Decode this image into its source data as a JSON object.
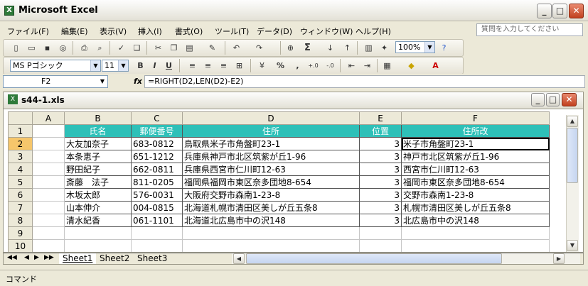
{
  "app": {
    "title": "Microsoft Excel"
  },
  "menu": {
    "items": [
      "ファイル(F)",
      "編集(E)",
      "表示(V)",
      "挿入(I)",
      "書式(O)",
      "ツール(T)",
      "データ(D)",
      "ウィンドウ(W)",
      "ヘルプ(H)"
    ],
    "help_placeholder": "質問を入力してください"
  },
  "toolbar": {
    "zoom": "100%",
    "font_name": "MS Pゴシック",
    "font_size": "11",
    "bold": "B",
    "italic": "I",
    "underline": "U",
    "percent": "%",
    "comma": ",",
    "sigma": "Σ"
  },
  "formula_bar": {
    "cell_ref": "F2",
    "fx": "fx",
    "formula": "=RIGHT(D2,LEN(D2)-E2)"
  },
  "workbook": {
    "title": "s44-1.xls"
  },
  "sheet": {
    "columns": [
      "A",
      "B",
      "C",
      "D",
      "E",
      "F"
    ],
    "row_numbers": [
      "1",
      "2",
      "3",
      "4",
      "5",
      "6",
      "7",
      "8",
      "9",
      "10"
    ],
    "header": [
      "氏名",
      "郵便番号",
      "住所",
      "位置",
      "住所改"
    ],
    "rows": [
      [
        "大友加奈子",
        "683-0812",
        "鳥取県米子市角盤町23-1",
        "3",
        "米子市角盤町23-1"
      ],
      [
        "本条恵子",
        "651-1212",
        "兵庫県神戸市北区筑紫が丘1-96",
        "3",
        "神戸市北区筑紫が丘1-96"
      ],
      [
        "野田紀子",
        "662-0811",
        "兵庫県西宮市仁川町12-63",
        "3",
        "西宮市仁川町12-63"
      ],
      [
        "斎藤　法子",
        "811-0205",
        "福岡県福岡市東区奈多団地8-654",
        "3",
        "福岡市東区奈多団地8-654"
      ],
      [
        "木坂太郎",
        "576-0031",
        "大阪府交野市森南1-23-8",
        "3",
        "交野市森南1-23-8"
      ],
      [
        "山本伸介",
        "004-0815",
        "北海道札幌市清田区美しが丘五条8",
        "3",
        "札幌市清田区美しが丘五条8"
      ],
      [
        "清水紀香",
        "061-1101",
        "北海道北広島市中の沢148",
        "3",
        "北広島市中の沢148"
      ]
    ]
  },
  "sheet_tabs": [
    "Sheet1",
    "Sheet2",
    "Sheet3"
  ],
  "status": {
    "mode": "コマンド"
  },
  "colors": {
    "header_bg": "#2ec0b8",
    "selected_header": "#f6c66b"
  }
}
